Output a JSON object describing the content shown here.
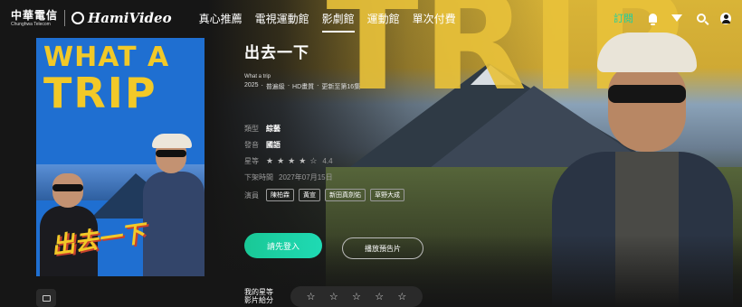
{
  "brand": {
    "cht_main": "中華電信",
    "cht_sub": "Chunghwa Telecom",
    "hami": "HamiVideo"
  },
  "nav": {
    "items": [
      "真心推薦",
      "電視運動館",
      "影劇館",
      "運動館",
      "單次付費"
    ],
    "active_index": 2,
    "subscribe": "訂閱"
  },
  "hero": {
    "letters": "TRIP"
  },
  "poster": {
    "line1": "WHAT A",
    "line2": "TRIP",
    "logo": "出去一下"
  },
  "show": {
    "title": "出去一下",
    "subtitle": "What a trip",
    "year": "2025",
    "rating_class": "普遍級",
    "quality": "HD畫質",
    "episodes": "更新至第16集",
    "sep": "‧"
  },
  "info": {
    "genre_label": "類型",
    "genre": "綜藝",
    "language_label": "發音",
    "language": "國語",
    "stars_label": "星等",
    "stars_glyphs": [
      "★",
      "★",
      "★",
      "★",
      "☆"
    ],
    "score": "4.4",
    "expire_label": "下架時間",
    "expire": "2027年07月15日",
    "cast_label": "演員",
    "cast": [
      "陳柏霖",
      "黃宣",
      "新田真劍佑",
      "草野大成"
    ]
  },
  "actions": {
    "login": "請先登入",
    "trailer": "播放預告片"
  },
  "my_rating": {
    "label_line1": "我的星等",
    "label_line2": "影片給分",
    "stars": [
      "☆",
      "☆",
      "☆",
      "☆",
      "☆"
    ]
  },
  "colors": {
    "accent": "#1fcf9e",
    "poster_yellow": "#f2c928",
    "poster_blue": "#1f6fd1"
  }
}
